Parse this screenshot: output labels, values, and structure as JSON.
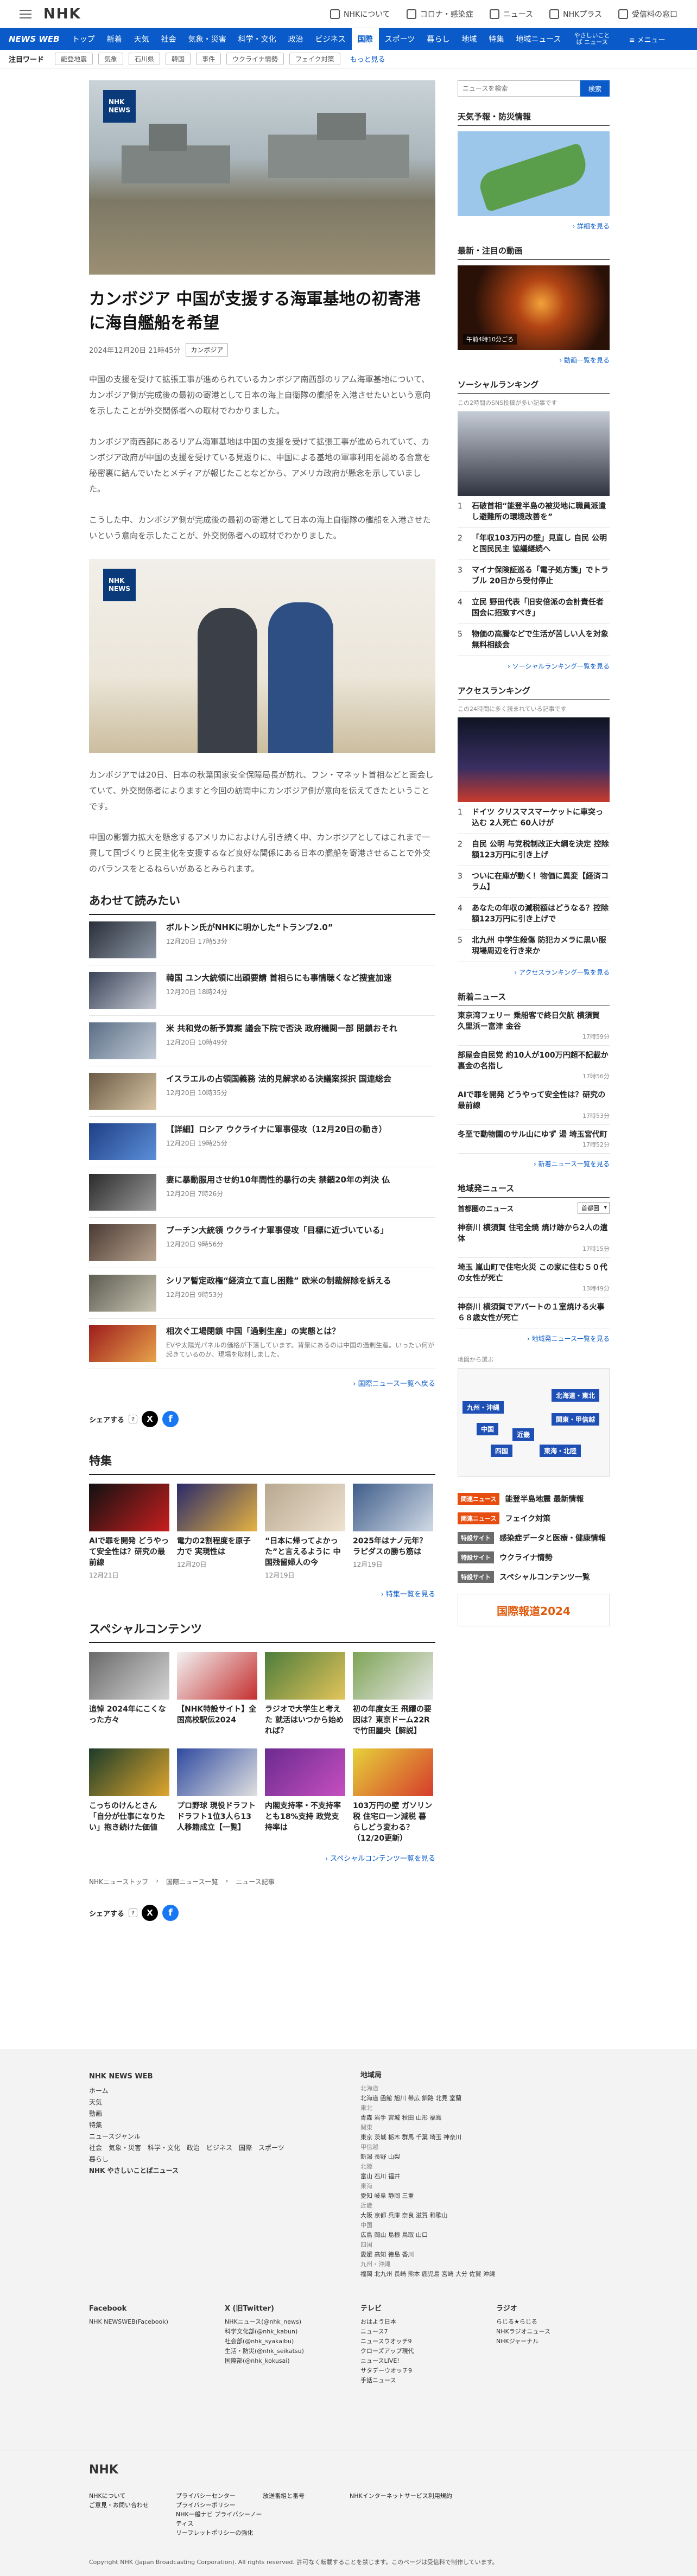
{
  "header": {
    "logo": "NHK",
    "services": [
      "NHKについて",
      "コロナ・感染症",
      "ニュース",
      "NHKプラス",
      "受信料の窓口"
    ]
  },
  "nav": {
    "brand": "NEWS WEB",
    "items": [
      "トップ",
      "新着",
      "天気",
      "社会",
      "気象・災害",
      "科学・文化",
      "政治",
      "ビジネス",
      "国際",
      "スポーツ",
      "暮らし",
      "地域",
      "特集",
      "地域ニュース"
    ],
    "active": "国際",
    "easy": "やさしいことば ニュース",
    "menu": "≡ メニュー"
  },
  "keywords": {
    "label": "注目ワード",
    "tags": [
      "能登地震",
      "気象",
      "石川県",
      "韓国",
      "事件",
      "ウクライナ情勢",
      "フェイク対策"
    ],
    "more": "もっと見る"
  },
  "article": {
    "title": "カンボジア 中国が支援する海軍基地の初寄港に海自艦船を希望",
    "date": "2024年12月20日 21時45分",
    "category": "カンボジア",
    "badge": "NHK\nNEWS",
    "p1": "中国の支援を受けて拡張工事が進められているカンボジア南西部のリアム海軍基地について、カンボジア側が完成後の最初の寄港として日本の海上自衛隊の艦船を入港させたいという意向を示したことが外交関係者への取材でわかりました。",
    "p2": "カンボジア南西部にあるリアム海軍基地は中国の支援を受けて拡張工事が進められていて、カンボジア政府が中国の支援を受けている見返りに、中国による基地の軍事利用を認める合意を秘密裏に結んでいたとメディアが報じたことなどから、アメリカ政府が懸念を示していました。",
    "p3": "こうした中、カンボジア側が完成後の最初の寄港として日本の海上自衛隊の艦船を入港させたいという意向を示したことが、外交関係者への取材でわかりました。",
    "p4": "カンボジアでは20日、日本の秋葉国家安全保障局長が訪れ、フン・マネット首相などと面会していて、外交関係者によりますと今回の訪問中にカンボジア側が意向を伝えてきたということです。",
    "p5": "中国の影響力拡大を懸念するアメリカにおよけん引き続く中、カンボジアとしてはこれまで一貫して国づくりと民主化を支援するなど良好な関係にある日本の艦船を寄港させることで外交のバランスをとるねらいがあるとみられます。"
  },
  "related": {
    "title": "あわせて読みたい",
    "more": "国際ニュース一覧へ戻る",
    "items": [
      {
        "title": "ボルトン氏がNHKに明かした“トランプ2.0”",
        "date": "12月20日 17時53分"
      },
      {
        "title": "韓国 ユン大統領に出頭要請 首相らにも事情聴くなど捜査加速",
        "date": "12月20日 18時24分"
      },
      {
        "title": "米 共和党の新予算案 議会下院で否決 政府機関一部 閉鎖おそれ",
        "date": "12月20日 10時49分"
      },
      {
        "title": "イスラエルの占領国義務 法的見解求める決議案採択 国連総会",
        "date": "12月20日 10時35分"
      },
      {
        "title": "【詳細】ロシア ウクライナに軍事侵攻（12月20日の動き）",
        "date": "12月20日 19時25分"
      },
      {
        "title": "妻に暴動服用させ約10年間性的暴行の夫 禁錮20年の判決 仏",
        "date": "12月20日 7時26分"
      },
      {
        "title": "プーチン大統領 ウクライナ軍事侵攻「目標に近づいている」",
        "date": "12月20日 9時56分"
      },
      {
        "title": "シリア暫定政権“経済立て直し困難” 欧米の制裁解除を訴える",
        "date": "12月20日 9時53分"
      },
      {
        "title": "相次ぐ工場閉鎖 中国「過剰生産」の実態とは？",
        "date": "EVや太陽光パネルの価格が下落しています。背景にあるのは中国の過剰生産。いったい何が起きているのか、現場を取材しました。"
      }
    ]
  },
  "share": {
    "label": "シェアする"
  },
  "features": {
    "title": "特集",
    "more": "特集一覧を見る",
    "items": [
      {
        "title": "AIで罪を開発 どうやって安全性は？研究の最前線",
        "date": "12月21日"
      },
      {
        "title": "電力の2割程度を原子力で 実現性は",
        "date": "12月20日"
      },
      {
        "title": "“日本に帰ってよかった”と言えるように 中国残留婦人の今",
        "date": "12月19日"
      },
      {
        "title": "2025年はナノ元年？ ラピダスの勝ち筋は",
        "date": "12月19日"
      }
    ]
  },
  "special": {
    "title": "スペシャルコンテンツ",
    "more": "スペシャルコンテンツ一覧を見る",
    "items": [
      "追悼 2024年にこくなった方々",
      "【NHK特設サイト】全国高校駅伝2024",
      "ラジオで大学生と考えた 就活はいつから始めれば？",
      "初の年度女王 飛躍の要因は？東京ドーム22Rで竹田麗央【解説】",
      "こっちのけんとさん「自分が仕事になりたい」抱き続けた価値",
      "プロ野球 現役ドラフト ドラフト1位3人ら13人移籍成立【一覧】",
      "内閣支持率・不支持率とも18%支持 政党支持率は",
      "103万円の壁 ガソリン税 住宅ローン減税 暮らしどう変わる？（12/20更新）"
    ]
  },
  "breadcrumb": [
    "NHKニューストップ",
    "国際ニュース一覧",
    "ニュース記事"
  ],
  "sidebar": {
    "search_placeholder": "ニュースを検索",
    "search_button": "検索",
    "weather": {
      "title": "天気予報・防災情報",
      "more": "詳細を見る"
    },
    "video": {
      "title": "最新・注目の動画",
      "caption": "午前4時10分ごろ",
      "more": "動画一覧を見る"
    },
    "social": {
      "title": "ソーシャルランキング",
      "sub": "この2時間のSNS投稿が多い記事です",
      "more": "ソーシャルランキング一覧を見る",
      "items": [
        "石破首相“能登半島の被災地に職員派遣し避難所の環境改善を”",
        "「年収103万円の壁」見直し 自民 公明と国民民主 協議継続へ",
        "マイナ保険証巡る「電子処方箋」でトラブル 20日から受付停止",
        "立民 野田代表「旧安倍派の会計責任者 国会に招致すべき」",
        "物価の高騰などで生活が苦しい人を対象 無料相談会"
      ]
    },
    "access": {
      "title": "アクセスランキング",
      "sub": "この24時間に多く読まれている記事です",
      "more": "アクセスランキング一覧を見る",
      "items": [
        "ドイツ クリスマスマーケットに車突っ込む 2人死亡 60人けが",
        "自民 公明 与党税制改正大綱を決定 控除額123万円に引き上げ",
        "ついに在庫が動く！物価に異変【経済コラム】",
        "あなたの年収の減税額はどうなる？控除額123万円に引き上げで",
        "北九州 中学生殺傷 防犯カメラに黒い服 現場周辺を行き来か"
      ]
    },
    "newarrivals": {
      "title": "新着ニュース",
      "more": "新着ニュース一覧を見る",
      "items": [
        {
          "title": "東京湾フェリー 乗船客で終日欠航 横須賀 久里浜ー富津 金谷",
          "date": "17時59分"
        },
        {
          "title": "部屋会自民党 約10人が100万円超不記載か 裏金の名指し",
          "date": "17時56分"
        },
        {
          "title": "AIで罪を開発 どうやって安全性は？研究の最前線",
          "date": "17時53分"
        },
        {
          "title": "冬至で動物園のサル山にゆず 湯 埼玉宮代町",
          "date": "17時52分"
        }
      ]
    },
    "regional": {
      "title": "地域発ニュース",
      "label": "首都圏のニュース",
      "select": "首都圏",
      "more": "地域発ニュース一覧を見る",
      "items": [
        {
          "title": "神奈川 横須賀 住宅全焼 焼け跡から2人の遺体",
          "date": "17時15分"
        },
        {
          "title": "埼玉 嵐山町で住宅火災 この家に住む５０代の女性が死亡",
          "date": "13時49分"
        },
        {
          "title": "神奈川 横須賀でアパートの１室焼ける火事 ６８歳女性が死亡",
          "date": ""
        }
      ]
    },
    "mapcap": "地図から選ぶ",
    "regions": [
      "北海道・東北",
      "関東・甲信越",
      "中国",
      "近畿",
      "東海・北陸",
      "四国",
      "九州・沖縄"
    ],
    "pills": [
      {
        "badge": "関連ニュース",
        "text": "能登半島地震 最新情報",
        "g": false
      },
      {
        "badge": "関連ニュース",
        "text": "フェイク対策",
        "g": false
      },
      {
        "badge": "特設サイト",
        "text": "感染症データと医療・健康情報",
        "g": true
      },
      {
        "badge": "特設サイト",
        "text": "ウクライナ情勢",
        "g": true
      },
      {
        "badge": "特設サイト",
        "text": "スペシャルコンテンツ一覧",
        "g": true
      }
    ],
    "banner": "国際報道2024"
  },
  "footer": {
    "col1_title": "NHK NEWS WEB",
    "col1": [
      "ホーム",
      "天気",
      "動画",
      "特集",
      "ニュースジャンル",
      "社会　気象・災害　科学・文化　政治　ビジネス　国際　スポーツ",
      "暮らし",
      "NHK やさしいことばニュース"
    ],
    "col2_title": "地域局",
    "col2": [
      "北海道",
      "北海道 函館 旭川 帯広 釧路 北見 室蘭",
      "東北",
      "青森 岩手 宮城 秋田 山形 福島",
      "関東",
      "東京 茨城 栃木 群馬 千葉 埼玉 神奈川",
      "甲信越",
      "新潟 長野 山梨",
      "北陸",
      "富山 石川 福井",
      "東海",
      "愛知 岐阜 静岡 三重",
      "近畿",
      "大阪 京都 兵庫 奈良 滋賀 和歌山",
      "中国",
      "広島 岡山 島根 鳥取 山口",
      "四国",
      "愛媛 高知 徳島 香川",
      "九州・沖縄",
      "福岡 北九州 長崎 熊本 鹿児島 宮崎 大分 佐賀 沖縄"
    ],
    "sns1_title": "Facebook",
    "sns1": [
      "NHK NEWSWEB(Facebook)"
    ],
    "sns2_title": "X (旧Twitter)",
    "sns2": [
      "NHKニュース(@nhk_news)",
      "科学文化部(@nhk_kabun)",
      "社会部(@nhk_syakaibu)",
      "生活・防災(@nhk_seikatsu)",
      "国際部(@nhk_kokusai)"
    ],
    "sns3_title": "テレビ",
    "sns3": [
      "おはよう日本",
      "ニュース7",
      "ニュースウオッチ9",
      "クローズアップ現代",
      "ニュースLIVE!",
      "サタデーウオッチ9",
      "手話ニュース"
    ],
    "sns4_title": "ラジオ",
    "sns4": [
      "らじる★らじる",
      "NHKラジオニュース",
      "NHKジャーナル"
    ],
    "links": [
      "NHKについて",
      "プライバシーセンター",
      "放送番組と番号",
      "NHKインターネットサービス利用規約",
      "ご意見・お問い合わせ",
      "プライバシーポリシー",
      "NHK一般ナビ プライバシーノーティス",
      "リーフレットポリシーの強化"
    ],
    "copyright": "Copyright NHK (Japan Broadcasting Corporation). All rights reserved. 許可なく転載することを禁じます。このページは受信料で制作しています。"
  }
}
